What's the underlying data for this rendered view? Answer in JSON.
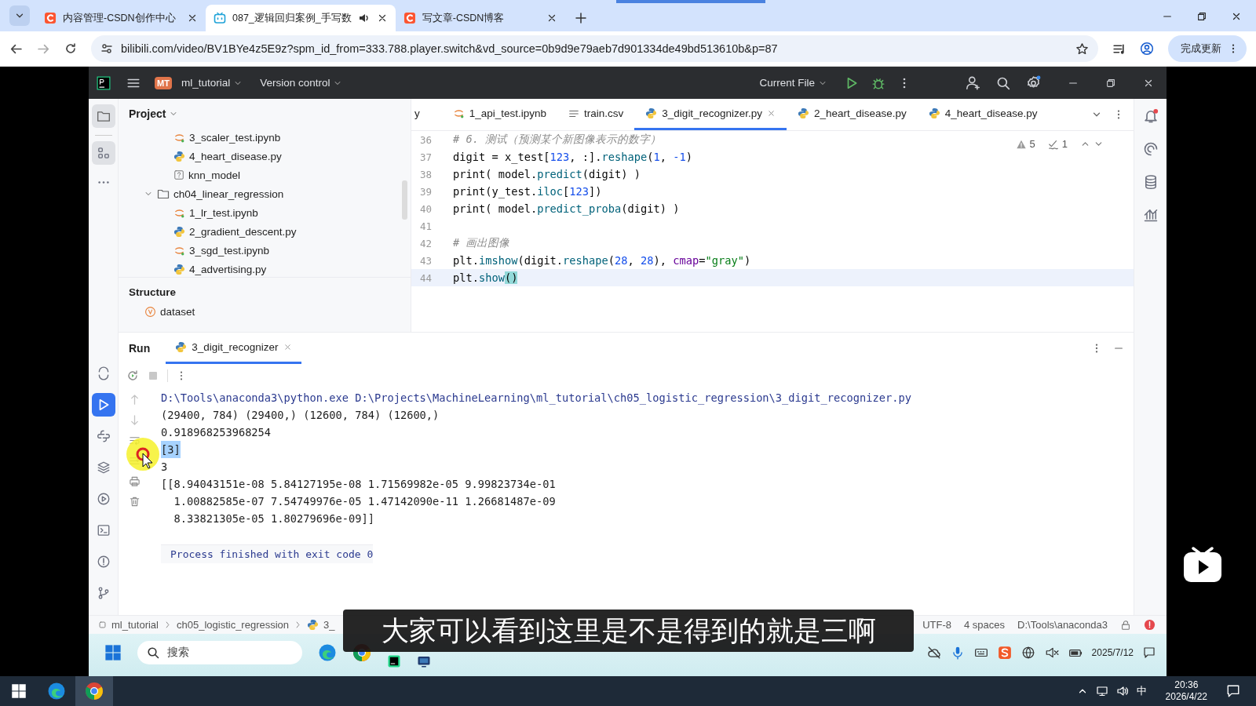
{
  "browser": {
    "tabs": [
      {
        "title": "内容管理-CSDN创作中心",
        "selected": false,
        "audio": false
      },
      {
        "title": "087_逻辑回归案例_手写数",
        "selected": true,
        "audio": true
      },
      {
        "title": "写文章-CSDN博客",
        "selected": false,
        "audio": false
      }
    ],
    "url": "bilibili.com/video/BV1BYe4z5E9z?spm_id_from=333.788.player.switch&vd_source=0b9d9e79aeb7d901334de49bd513610b&p=87",
    "update_button": "完成更新"
  },
  "ide": {
    "project_badge": "MT",
    "project": "ml_tutorial",
    "vcs": "Version control",
    "run_config": "Current File",
    "project_panel": {
      "title": "Project",
      "tree": [
        {
          "kind": "notebook",
          "name": "3_scaler_test.ipynb"
        },
        {
          "kind": "python",
          "name": "4_heart_disease.py"
        },
        {
          "kind": "unknown",
          "name": "knn_model"
        },
        {
          "kind": "folder",
          "name": "ch04_linear_regression",
          "expanded": true,
          "children": [
            {
              "kind": "notebook",
              "name": "1_lr_test.ipynb"
            },
            {
              "kind": "python",
              "name": "2_gradient_descent.py"
            },
            {
              "kind": "notebook",
              "name": "3_sgd_test.ipynb"
            },
            {
              "kind": "python",
              "name": "4_advertising.py"
            }
          ]
        }
      ]
    },
    "structure": {
      "title": "Structure",
      "items": [
        "dataset"
      ]
    },
    "editor_tabs": [
      {
        "label": "y",
        "selected": false
      },
      {
        "label": "1_api_test.ipynb",
        "selected": false
      },
      {
        "label": "train.csv",
        "selected": false
      },
      {
        "label": "3_digit_recognizer.py",
        "selected": true
      },
      {
        "label": "2_heart_disease.py",
        "selected": false
      },
      {
        "label": "4_heart_disease.py",
        "selected": false
      }
    ],
    "inspections": {
      "warnings": "5",
      "weak_warnings": "1"
    },
    "code": [
      {
        "no": "36",
        "current": false,
        "tokens": [
          {
            "t": "# 6. 测试（预测某个新图像表示的数字）",
            "kind": "comment"
          }
        ]
      },
      {
        "no": "37",
        "current": false,
        "tokens": [
          {
            "t": "digit = x_test[",
            "kind": "plain"
          },
          {
            "t": "123",
            "kind": "num"
          },
          {
            "t": ", :].",
            "kind": "plain"
          },
          {
            "t": "reshape",
            "kind": "fn"
          },
          {
            "t": "(",
            "kind": "plain"
          },
          {
            "t": "1",
            "kind": "num"
          },
          {
            "t": ", ",
            "kind": "plain"
          },
          {
            "t": "-1",
            "kind": "num"
          },
          {
            "t": ")",
            "kind": "plain"
          }
        ]
      },
      {
        "no": "38",
        "current": false,
        "tokens": [
          {
            "t": "print( model.",
            "kind": "plain"
          },
          {
            "t": "predict",
            "kind": "fn"
          },
          {
            "t": "(digit) )",
            "kind": "plain"
          }
        ]
      },
      {
        "no": "39",
        "current": false,
        "tokens": [
          {
            "t": "print(y_test.",
            "kind": "plain"
          },
          {
            "t": "iloc",
            "kind": "fn"
          },
          {
            "t": "[",
            "kind": "plain"
          },
          {
            "t": "123",
            "kind": "num"
          },
          {
            "t": "])",
            "kind": "plain"
          }
        ]
      },
      {
        "no": "40",
        "current": false,
        "tokens": [
          {
            "t": "print( model.",
            "kind": "plain"
          },
          {
            "t": "predict_proba",
            "kind": "fn"
          },
          {
            "t": "(digit) )",
            "kind": "plain"
          }
        ]
      },
      {
        "no": "41",
        "current": false
      },
      {
        "no": "42",
        "current": false,
        "tokens": [
          {
            "t": "# 画出图像",
            "kind": "comment"
          }
        ]
      },
      {
        "no": "43",
        "current": false,
        "tokens": [
          {
            "t": "plt.",
            "kind": "plain"
          },
          {
            "t": "imshow",
            "kind": "fn"
          },
          {
            "t": "(digit.",
            "kind": "plain"
          },
          {
            "t": "reshape",
            "kind": "fn"
          },
          {
            "t": "(",
            "kind": "plain"
          },
          {
            "t": "28",
            "kind": "num"
          },
          {
            "t": ", ",
            "kind": "plain"
          },
          {
            "t": "28",
            "kind": "num"
          },
          {
            "t": "), ",
            "kind": "plain"
          },
          {
            "t": "cmap",
            "kind": "param"
          },
          {
            "t": "=",
            "kind": "plain"
          },
          {
            "t": "\"gray\"",
            "kind": "str"
          },
          {
            "t": ")",
            "kind": "plain"
          }
        ]
      },
      {
        "no": "44",
        "current": true,
        "tokens": [
          {
            "t": "plt.",
            "kind": "plain"
          },
          {
            "t": "show",
            "kind": "fn"
          },
          {
            "t": "()",
            "kind": "match"
          }
        ]
      }
    ],
    "run": {
      "title": "Run",
      "tab": "3_digit_recognizer",
      "output": [
        {
          "kind": "command",
          "text": "D:\\Tools\\anaconda3\\python.exe D:\\Projects\\MachineLearning\\ml_tutorial\\ch05_logistic_regression\\3_digit_recognizer.py",
          "selected": false
        },
        {
          "kind": "output",
          "text": "(29400, 784) (29400,) (12600, 784) (12600,)",
          "selected": false
        },
        {
          "kind": "output",
          "text": "0.918968253968254",
          "selected": false
        },
        {
          "kind": "output",
          "text": "[3]",
          "selected": true
        },
        {
          "kind": "output",
          "text": "3",
          "selected": false
        },
        {
          "kind": "output",
          "text": "[[8.94043151e-08 5.84127195e-08 1.71569982e-05 9.99823734e-01",
          "selected": false
        },
        {
          "kind": "output",
          "text": "  1.00882585e-07 7.54749976e-05 1.47142090e-11 1.26681487e-09",
          "selected": false
        },
        {
          "kind": "output",
          "text": "  8.33821305e-05 1.80279696e-09]]",
          "selected": false
        },
        {
          "kind": "status",
          "text": "Process finished with exit code 0",
          "selected": false
        }
      ]
    },
    "status_bar": {
      "breadcrumb": [
        "ml_tutorial",
        "ch05_logistic_regression",
        "3_"
      ],
      "right": [
        "UTF-8",
        "4 spaces",
        "D:\\Tools\\anaconda3"
      ]
    },
    "inner_taskbar": {
      "search": "搜索",
      "date": "2025/7/12"
    }
  },
  "subtitle": "大家可以看到这里是不是得到的就是三啊",
  "taskbar": {
    "ime": "中",
    "time": "20:36",
    "date": "2026/4/22"
  }
}
